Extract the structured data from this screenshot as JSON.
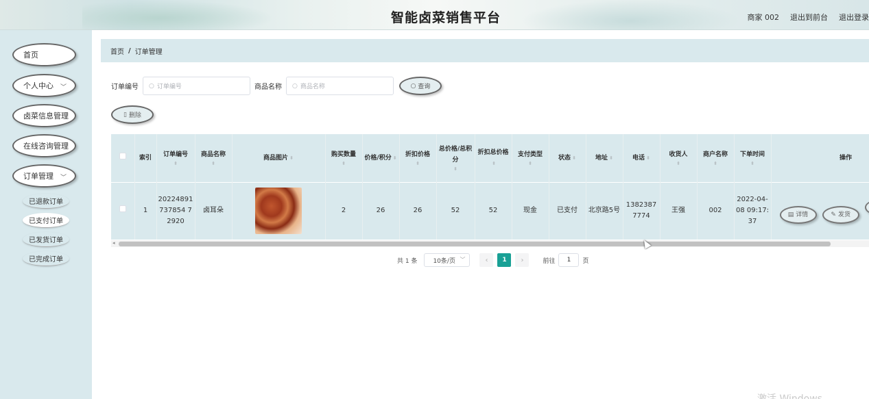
{
  "header": {
    "title": "智能卤菜销售平台",
    "user": "商家 002",
    "back_to_front": "退出到前台",
    "logout": "退出登录"
  },
  "sidebar": {
    "items": [
      {
        "label": "首页"
      },
      {
        "label": "个人中心",
        "icon": "chevron-down-icon"
      },
      {
        "label": "卤菜信息管理"
      },
      {
        "label": "在线咨询管理"
      },
      {
        "label": "订单管理",
        "icon": "chevron-down-icon"
      }
    ],
    "sub_items": [
      {
        "label": "已退款订单"
      },
      {
        "label": "已支付订单",
        "active": true
      },
      {
        "label": "已发货订单"
      },
      {
        "label": "已完成订单"
      }
    ]
  },
  "breadcrumb": {
    "home": "首页",
    "separator": "/",
    "current": "订单管理"
  },
  "filters": {
    "order_no_label": "订单编号",
    "order_no_placeholder": "订单编号",
    "product_label": "商品名称",
    "product_placeholder": "商品名称",
    "query_label": "查询",
    "delete_label": "删除"
  },
  "table": {
    "headers": {
      "index": "索引",
      "order_no": "订单编号",
      "product_name": "商品名称",
      "product_image": "商品图片",
      "quantity": "购买数量",
      "price": "价格/积分",
      "discount_price": "折扣价格",
      "total": "总价格/总积分",
      "discount_total": "折扣总价格",
      "pay_type": "支付类型",
      "status": "状态",
      "address": "地址",
      "phone": "电话",
      "receiver": "收货人",
      "merchant": "商户名称",
      "order_time": "下单时间",
      "actions": "操作"
    },
    "rows": [
      {
        "index": "1",
        "order_no": "20224891737854 72920",
        "product_name": "卤耳朵",
        "quantity": "2",
        "price": "26",
        "discount_price": "26",
        "total": "52",
        "discount_total": "52",
        "pay_type": "现金",
        "status": "已支付",
        "address": "北京路5号",
        "phone": "13823877774",
        "receiver": "王强",
        "merchant": "002",
        "order_time": "2022-04-08 09:17:37",
        "detail_label": "详情",
        "ship_label": "发货"
      }
    ]
  },
  "pagination": {
    "total": "共 1 条",
    "page_size": "10条/页",
    "current_page": "1",
    "goto_label": "前往",
    "goto_value": "1",
    "page_suffix": "页"
  },
  "watermark": "激活 Windows",
  "colors": {
    "sidebar_bg": "#d9e9ed",
    "active_page": "#19a095"
  }
}
